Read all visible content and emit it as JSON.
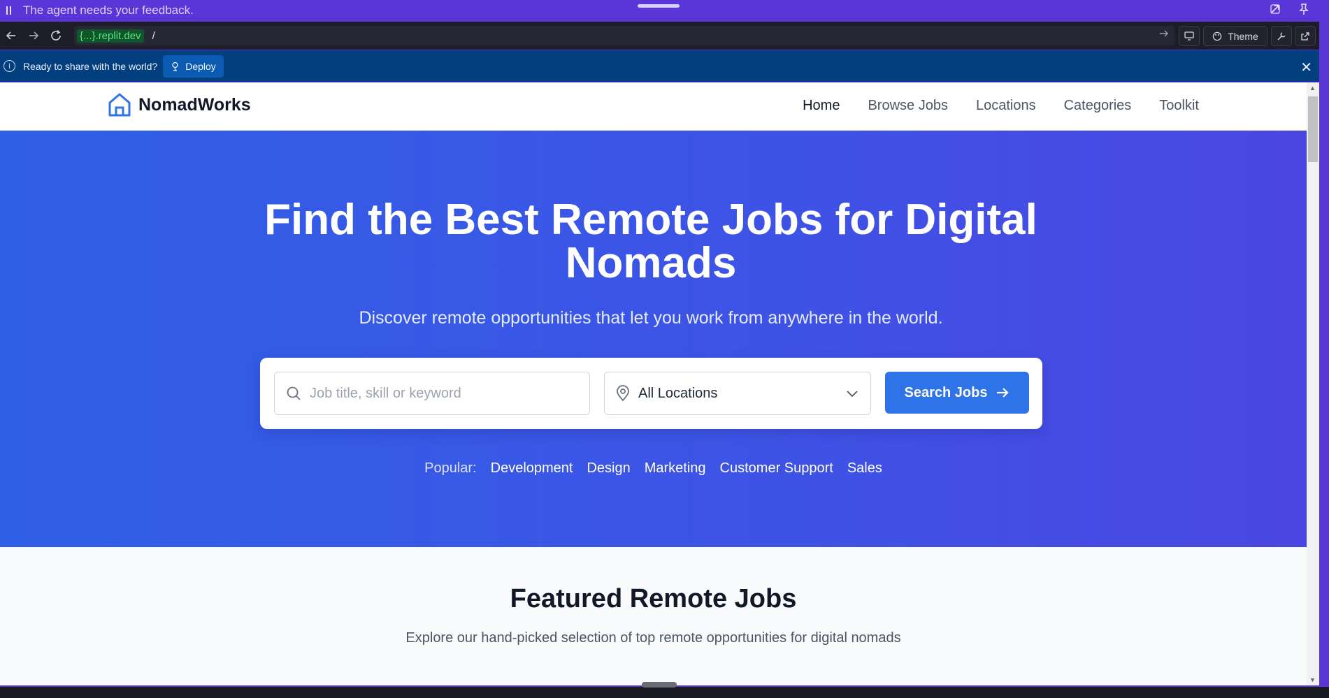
{
  "agent_bar": {
    "message": "The agent needs your feedback."
  },
  "url_bar": {
    "host": "{...}.replit.dev",
    "path": "/",
    "theme_label": "Theme"
  },
  "banner": {
    "text": "Ready to share with the world?",
    "deploy_label": "Deploy"
  },
  "site": {
    "brand": "NomadWorks",
    "nav": [
      {
        "label": "Home"
      },
      {
        "label": "Browse Jobs"
      },
      {
        "label": "Locations"
      },
      {
        "label": "Categories"
      },
      {
        "label": "Toolkit"
      }
    ],
    "hero": {
      "title": "Find the Best Remote Jobs for Digital Nomads",
      "subtitle": "Discover remote opportunities that let you work from anywhere in the world.",
      "keyword_placeholder": "Job title, skill or keyword",
      "location_value": "All Locations",
      "search_label": "Search Jobs",
      "popular_label": "Popular:",
      "popular_tags": [
        "Development",
        "Design",
        "Marketing",
        "Customer Support",
        "Sales"
      ]
    },
    "featured": {
      "title": "Featured Remote Jobs",
      "subtitle": "Explore our hand-picked selection of top remote opportunities for digital nomads"
    }
  },
  "colors": {
    "agent_bar": "#5a35d8",
    "banner": "#033f7f",
    "hero_start": "#2f5fe6",
    "hero_end": "#4a46e2",
    "primary_button": "#2f73e8",
    "brand_icon": "#2f73e8"
  }
}
